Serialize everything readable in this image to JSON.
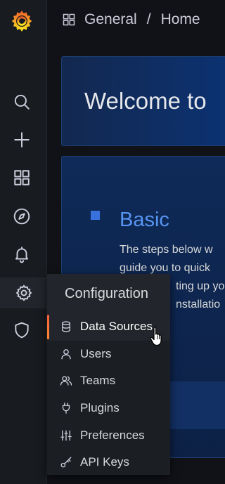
{
  "topbar": {
    "folder": "General",
    "separator": "/",
    "dashboard": "Home"
  },
  "sidebar": {
    "items": [
      {
        "name": "search",
        "icon": "search-icon"
      },
      {
        "name": "create",
        "icon": "plus-icon"
      },
      {
        "name": "dashboards",
        "icon": "apps-icon"
      },
      {
        "name": "explore",
        "icon": "compass-icon"
      },
      {
        "name": "alerting",
        "icon": "bell-icon"
      },
      {
        "name": "configuration",
        "icon": "gear-icon",
        "active": true
      },
      {
        "name": "server-admin",
        "icon": "shield-icon"
      }
    ]
  },
  "welcome": {
    "title": "Welcome to"
  },
  "basic": {
    "title": "Basic",
    "lines": [
      "The steps below w",
      "guide you to quick",
      "ting up yo",
      "nstallatio"
    ]
  },
  "config_menu": {
    "header": "Configuration",
    "items": [
      {
        "label": "Data Sources",
        "icon": "database-icon",
        "active": true
      },
      {
        "label": "Users",
        "icon": "user-icon"
      },
      {
        "label": "Teams",
        "icon": "users-icon"
      },
      {
        "label": "Plugins",
        "icon": "plug-icon"
      },
      {
        "label": "Preferences",
        "icon": "sliders-icon"
      },
      {
        "label": "API Keys",
        "icon": "key-icon"
      }
    ]
  },
  "colors": {
    "accent": "#5794f2",
    "active_bar": "#f55f3e",
    "sidebar_bg": "#181b1f"
  }
}
